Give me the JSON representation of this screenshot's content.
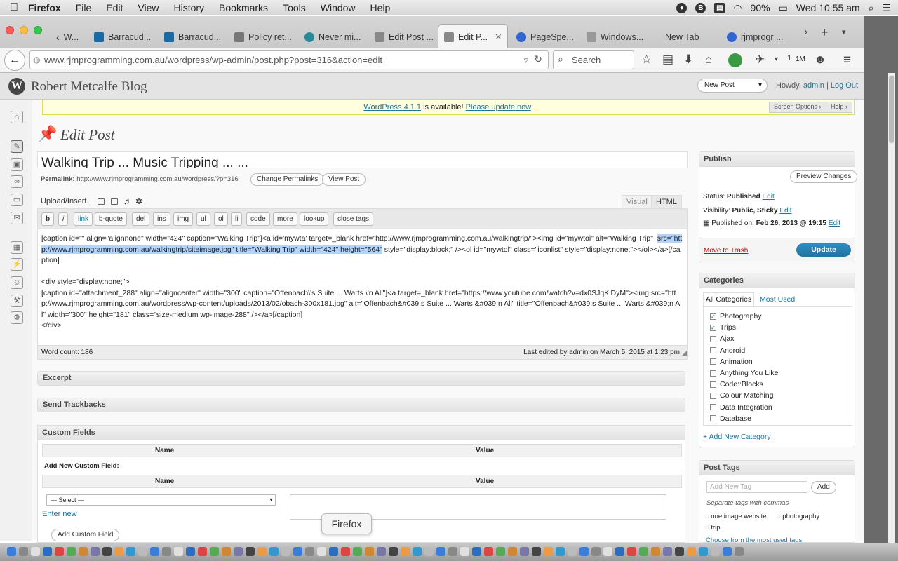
{
  "menubar": {
    "apple": "",
    "app": "Firefox",
    "items": [
      "File",
      "Edit",
      "View",
      "History",
      "Bookmarks",
      "Tools",
      "Window",
      "Help"
    ],
    "battery": "90%",
    "clock": "Wed 10:55 am"
  },
  "tabs": [
    {
      "label": "W...",
      "color": "#888888"
    },
    {
      "label": "Barracud...",
      "color": "#1a6aa6"
    },
    {
      "label": "Barracud...",
      "color": "#1a6aa6"
    },
    {
      "label": "Policy ret...",
      "color": "#777777"
    },
    {
      "label": "Never mi...",
      "color": "#2b8a99"
    },
    {
      "label": "Edit Post ...",
      "color": "#777777"
    },
    {
      "label": "Edit P...",
      "color": "#777777",
      "active": true
    },
    {
      "label": "PageSpe...",
      "color": "#3366cc"
    },
    {
      "label": "Windows...",
      "color": "#777777"
    },
    {
      "label": "New Tab",
      "color": ""
    },
    {
      "label": "rjmprogr ...",
      "color": "#3366cc"
    }
  ],
  "nav": {
    "url": "www.rjmprogramming.com.au/wordpress/wp-admin/post.php?post=316&action=edit",
    "search_placeholder": "Search",
    "badge": "1",
    "badge2": "1M"
  },
  "wp": {
    "blog_name": "Robert Metcalfe Blog",
    "new_post": "New Post",
    "howdy": "Howdy,",
    "user": "admin",
    "logout": "Log Out",
    "nag_link": "WordPress 4.1.1",
    "nag_text": " is available! ",
    "nag_update": "Please update now",
    "nag_end": ".",
    "screen_options": "Screen Options",
    "help": "Help",
    "page_title": "Edit Post",
    "post_title": "Walking Trip ... Music Tripping ... ...",
    "permalink_label": "Permalink:",
    "permalink_url": "http://www.rjmprogramming.com.au/wordpress/?p=316",
    "change_permalinks": "Change Permalinks",
    "view_post": "View Post",
    "upload_insert": "Upload/Insert",
    "visual_tab": "Visual",
    "html_tab": "HTML",
    "quicktags": [
      "b",
      "i",
      "link",
      "b-quote",
      "del",
      "ins",
      "img",
      "ul",
      "ol",
      "li",
      "code",
      "more",
      "lookup",
      "close tags"
    ],
    "content_pre": "[caption id=\"\" align=\"alignnone\" width=\"424\" caption=\"Walking Trip\"]<a id='mywta' target=_blank href=\"http://www.rjmprogramming.com.au/walkingtrip/\"><img id=\"mywtoi\" alt=\"Walking Trip\"  ",
    "content_hl": "src=\"http://www.rjmprogramming.com.au/walkingtrip/siteimage.jpg\" title=\"Walking Trip\" width=\"424\" height=\"564\"",
    "content_post": " style=\"display:block;\" /><ol id=\"mywtol\" class=\"iconlist\" style=\"display:none;\"></ol></a>[/caption]\n\n<div style=\"display:none;\">\n[caption id=\"attachment_288\" align=\"aligncenter\" width=\"300\" caption=\"Offenbach\\'s Suite ... Warts \\'n All\"]<a target=_blank href=\"https://www.youtube.com/watch?v=dx0SJqKlDyM\"><img src=\"http://www.rjmprogramming.com.au/wordpress/wp-content/uploads/2013/02/obach-300x181.jpg\" alt=\"Offenbach&#039;s Suite ... Warts &#039;n All\" title=\"Offenbach&#039;s Suite ... Warts &#039;n All\" width=\"300\" height=\"181\" class=\"size-medium wp-image-288\" /></a>[/caption]\n</div>",
    "word_count": "Word count: 186",
    "last_edited": "Last edited by admin on March 5, 2015 at 1:23 pm",
    "excerpt": "Excerpt",
    "send_trackbacks": "Send Trackbacks",
    "custom_fields": "Custom Fields",
    "cf_name": "Name",
    "cf_value": "Value",
    "add_new_cf": "Add New Custom Field:",
    "select_placeholder": "— Select —",
    "enter_new": "Enter new",
    "add_custom_field": "Add Custom Field",
    "publish": {
      "title": "Publish",
      "preview": "Preview Changes",
      "status_label": "Status:",
      "status": "Published",
      "edit": "Edit",
      "visibility_label": "Visibility:",
      "visibility": "Public, Sticky",
      "published_on_label": "Published on:",
      "published_on": "Feb 26, 2013 @ 19:15",
      "trash": "Move to Trash",
      "update": "Update"
    },
    "categories": {
      "title": "Categories",
      "tab_all": "All Categories",
      "tab_used": "Most Used",
      "items": [
        {
          "label": "Photography",
          "checked": true
        },
        {
          "label": "Trips",
          "checked": true
        },
        {
          "label": "Ajax",
          "checked": false
        },
        {
          "label": "Android",
          "checked": false
        },
        {
          "label": "Animation",
          "checked": false
        },
        {
          "label": "Anything You Like",
          "checked": false
        },
        {
          "label": "Code::Blocks",
          "checked": false
        },
        {
          "label": "Colour Matching",
          "checked": false
        },
        {
          "label": "Data Integration",
          "checked": false
        },
        {
          "label": "Database",
          "checked": false
        }
      ],
      "add_new": "+ Add New Category"
    },
    "tags": {
      "title": "Post Tags",
      "placeholder": "Add New Tag",
      "add": "Add",
      "hint": "Separate tags with commas",
      "tag1": "one image website",
      "tag2": "photography",
      "tag3": "trip",
      "most_used": "Choose from the most used tags"
    }
  },
  "tooltip": "Firefox"
}
